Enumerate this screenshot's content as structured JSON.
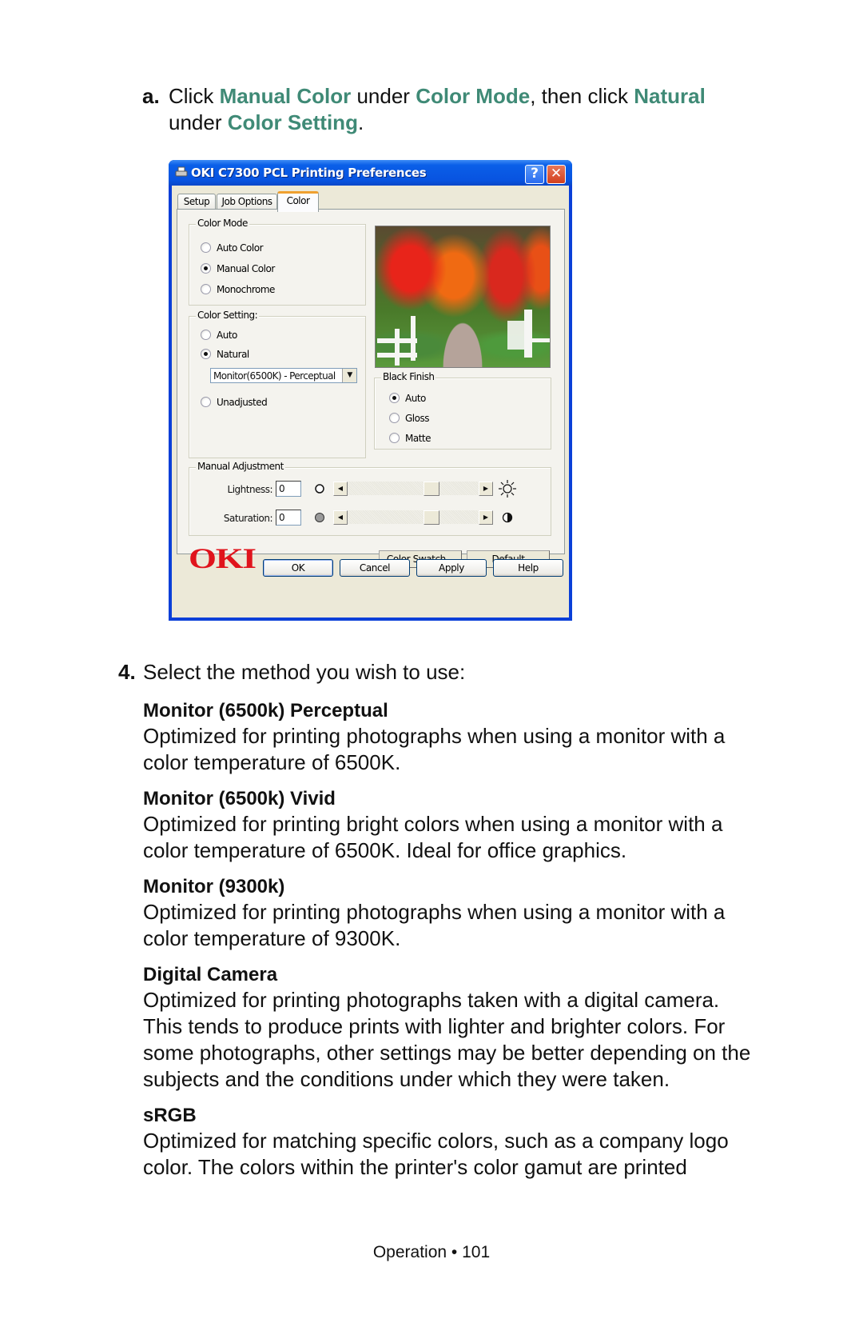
{
  "step_a": {
    "label": "a.",
    "parts": [
      "Click ",
      "Manual Color",
      " under ",
      "Color Mode",
      ", then click ",
      "Natural",
      " under ",
      "Color Setting",
      "."
    ]
  },
  "dialog": {
    "title": "OKI C7300 PCL Printing Preferences",
    "help_button": "?",
    "close_button": "✕",
    "tabs": [
      {
        "label": "Setup",
        "active": false
      },
      {
        "label": "Job Options",
        "active": false
      },
      {
        "label": "Color",
        "active": true
      }
    ],
    "color_mode": {
      "title": "Color Mode",
      "options": [
        {
          "label": "Auto Color",
          "selected": false
        },
        {
          "label": "Manual Color",
          "selected": true
        },
        {
          "label": "Monochrome",
          "selected": false
        }
      ]
    },
    "color_setting": {
      "title": "Color Setting:",
      "options": [
        {
          "label": "Auto",
          "selected": false
        },
        {
          "label": "Natural",
          "selected": true
        },
        {
          "label": "Unadjusted",
          "selected": false
        }
      ],
      "natural_select_value": "Monitor(6500K) - Perceptual",
      "dropdown_arrow": "▼"
    },
    "black_finish": {
      "title": "Black Finish",
      "options": [
        {
          "label": "Auto",
          "selected": true
        },
        {
          "label": "Gloss",
          "selected": false
        },
        {
          "label": "Matte",
          "selected": false
        }
      ]
    },
    "manual_adjustment": {
      "title": "Manual Adjustment",
      "lightness": {
        "label": "Lightness:",
        "value": "0",
        "slider_fraction": 0.5,
        "left_icon": "circle-outline-icon",
        "right_icon": "sun-icon"
      },
      "saturation": {
        "label": "Saturation:",
        "value": "0",
        "slider_fraction": 0.5,
        "left_icon": "gray-circle-icon",
        "right_icon": "half-circle-icon"
      },
      "left_arrow": "◀",
      "right_arrow": "▶"
    },
    "logo": "OKI",
    "color_swatch_button": "Color Swatch...",
    "default_button": "Default",
    "ok_button": "OK",
    "cancel_button": "Cancel",
    "apply_button": "Apply",
    "help_btn": "Help"
  },
  "step_4": {
    "number": "4.",
    "text": "Select the method you wish to use:"
  },
  "methods": [
    {
      "title": "Monitor (6500k) Perceptual",
      "lines": [
        "Optimized for printing photographs when using a monitor with a",
        "color temperature of 6500K."
      ]
    },
    {
      "title": "Monitor (6500k) Vivid",
      "lines": [
        "Optimized for printing bright colors when using a monitor with a",
        "color temperature of 6500K. Ideal for office graphics."
      ]
    },
    {
      "title": "Monitor (9300k)",
      "lines": [
        "Optimized for printing photographs when using a monitor with a",
        "color temperature of 9300K."
      ]
    },
    {
      "title": "Digital Camera",
      "lines": [
        "Optimized for printing photographs taken with a digital camera.",
        "This tends to produce prints with lighter and brighter colors. For",
        "some photographs, other settings may be better depending on the",
        "subjects and the conditions under which they were taken."
      ]
    },
    {
      "title": "sRGB",
      "lines": [
        "Optimized for matching specific colors, such as a company logo",
        "color. The colors within the printer's color gamut are printed"
      ]
    }
  ],
  "footer": "Operation • 101"
}
